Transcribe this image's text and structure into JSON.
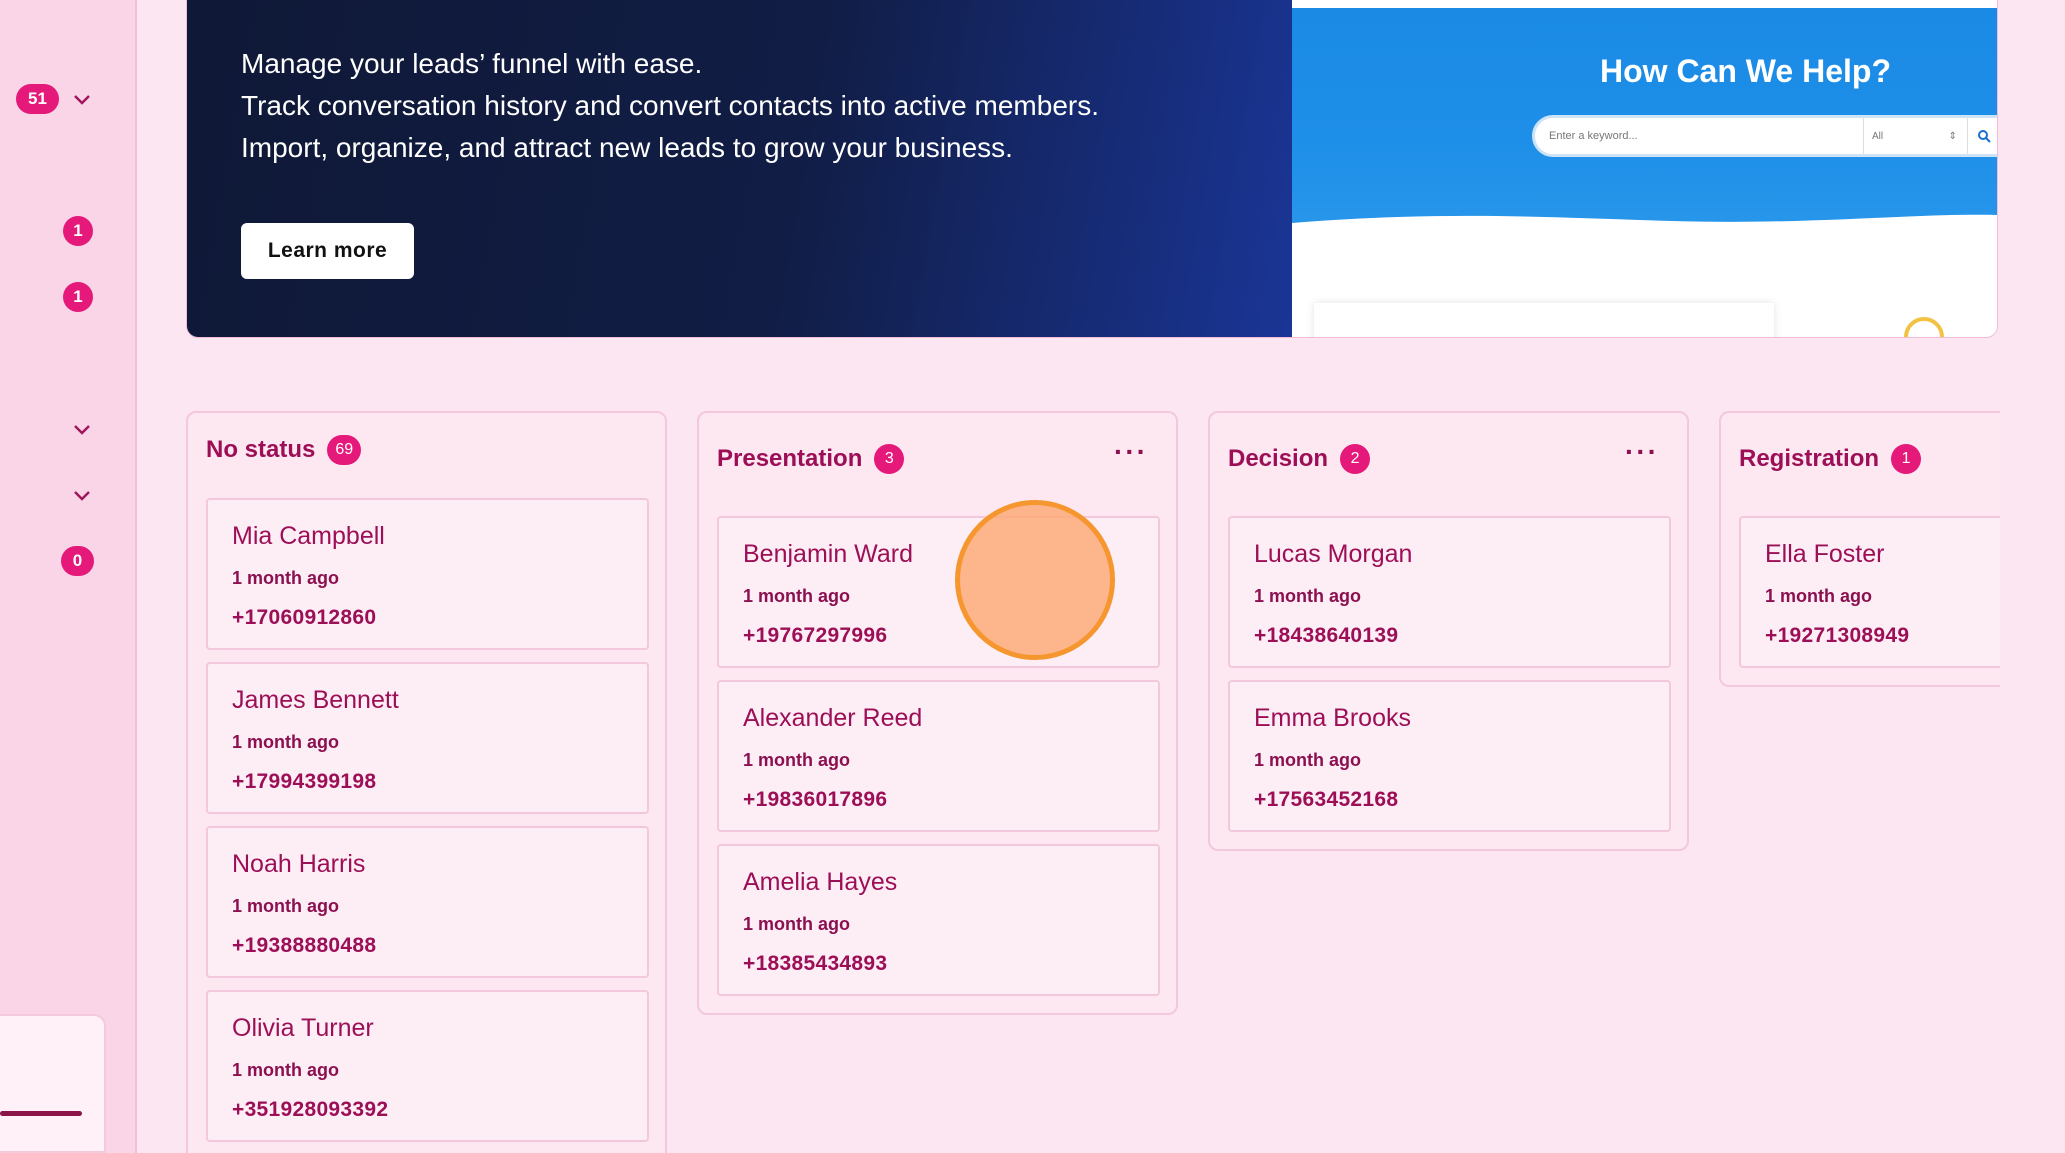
{
  "sidebar": {
    "badges": [
      "51",
      "1",
      "1",
      "0"
    ]
  },
  "hero": {
    "lines": [
      "Manage your leads’ funnel with ease.",
      "Track conversation history and convert contacts into active members.",
      "Import, organize, and attract new leads to grow your business."
    ],
    "learn_more_label": "Learn more",
    "preview": {
      "title": "How Can We Help?",
      "search_placeholder": "Enter a keyword...",
      "select_value": "All"
    }
  },
  "board": {
    "columns": [
      {
        "title": "No status",
        "count": "69",
        "cards": [
          {
            "name": "Mia Campbell",
            "time": "1 month ago",
            "phone": "+17060912860"
          },
          {
            "name": "James Bennett",
            "time": "1 month ago",
            "phone": "+17994399198"
          },
          {
            "name": "Noah Harris",
            "time": "1 month ago",
            "phone": "+19388880488"
          },
          {
            "name": "Olivia Turner",
            "time": "1 month ago",
            "phone": "+351928093392"
          }
        ]
      },
      {
        "title": "Presentation",
        "count": "3",
        "cards": [
          {
            "name": "Benjamin Ward",
            "time": "1 month ago",
            "phone": "+19767297996"
          },
          {
            "name": "Alexander Reed",
            "time": "1 month ago",
            "phone": "+19836017896"
          },
          {
            "name": "Amelia Hayes",
            "time": "1 month ago",
            "phone": "+18385434893"
          }
        ]
      },
      {
        "title": "Decision",
        "count": "2",
        "cards": [
          {
            "name": "Lucas Morgan",
            "time": "1 month ago",
            "phone": "+18438640139"
          },
          {
            "name": "Emma Brooks",
            "time": "1 month ago",
            "phone": "+17563452168"
          }
        ]
      },
      {
        "title": "Registration",
        "count": "1",
        "cards": [
          {
            "name": "Ella Foster",
            "time": "1 month ago",
            "phone": "+19271308949"
          }
        ]
      }
    ]
  },
  "colors": {
    "accent": "#e5197a",
    "title": "#9c0f57",
    "background": "#fce6f1"
  }
}
